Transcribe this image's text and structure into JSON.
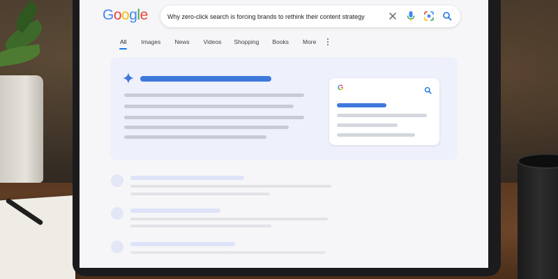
{
  "logo": {
    "letters": [
      "G",
      "o",
      "o",
      "g",
      "l",
      "e"
    ],
    "colors": [
      "#4285F4",
      "#EA4335",
      "#FBBC05",
      "#4285F4",
      "#34A853",
      "#EA4335"
    ]
  },
  "search": {
    "query": "Why zero-click search is forcing brands to rethink their content strategy",
    "clear_icon": "close-icon",
    "voice_icon": "microphone-icon",
    "lens_icon": "camera-lens-icon",
    "submit_icon": "search-icon"
  },
  "tabs": [
    {
      "label": "All",
      "active": true
    },
    {
      "label": "Images",
      "active": false
    },
    {
      "label": "News",
      "active": false
    },
    {
      "label": "Videos",
      "active": false
    },
    {
      "label": "Shopping",
      "active": false
    },
    {
      "label": "Books",
      "active": false
    },
    {
      "label": "More",
      "active": false
    }
  ],
  "more_options_icon": "vertical-dots-icon",
  "ai_overview": {
    "icon": "sparkle-icon",
    "accent": "#3f78dd"
  },
  "mini_card": {
    "logo_letter": "G",
    "search_icon": "search-icon"
  },
  "colors": {
    "page_bg": "#f6f6f8",
    "ai_card_bg": "#eef1fb",
    "placeholder_gray": "#c8cbd3",
    "accent_blue": "#1a73e8"
  }
}
